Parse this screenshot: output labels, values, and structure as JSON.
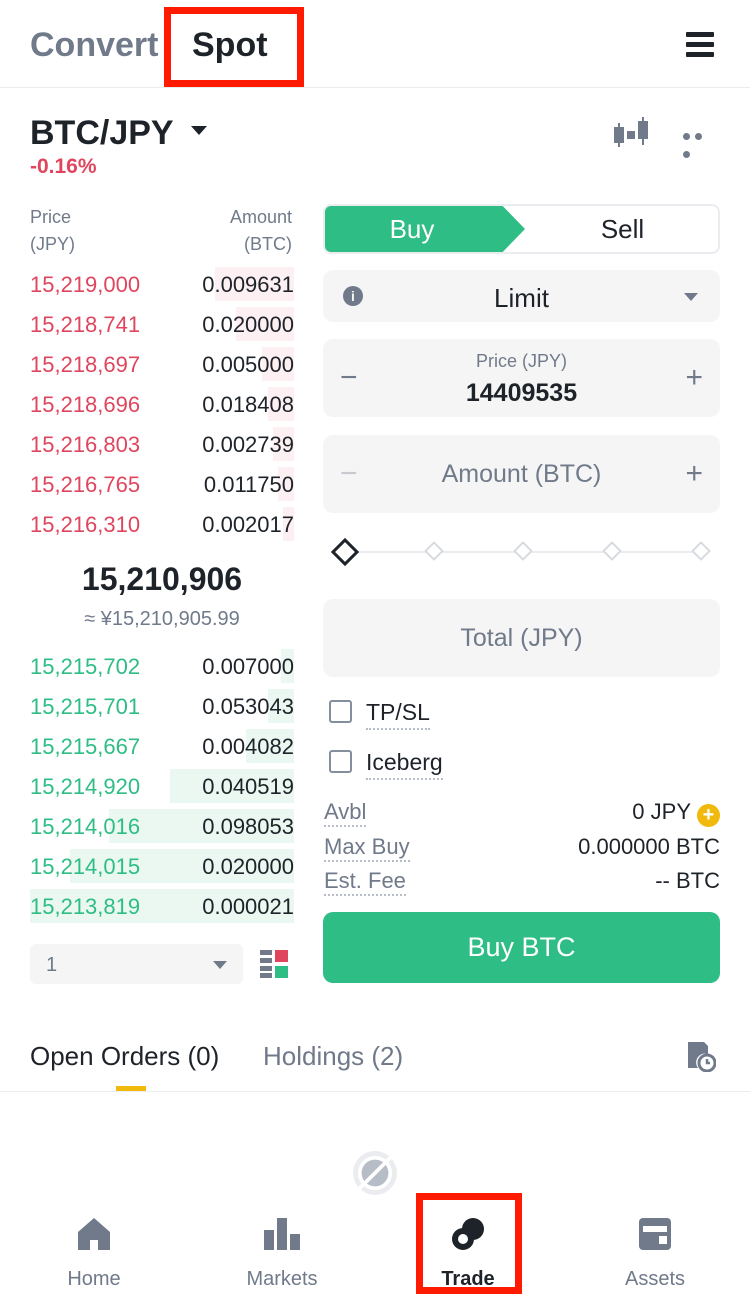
{
  "header": {
    "tab_convert": "Convert",
    "tab_spot": "Spot"
  },
  "market": {
    "pair": "BTC/JPY",
    "change": "-0.16%"
  },
  "orderbook": {
    "price_label": [
      "Price",
      "(JPY)"
    ],
    "amount_label": [
      "Amount",
      "(BTC)"
    ],
    "asks": [
      {
        "price": "15,219,000",
        "amount": "0.009631",
        "depth": 0.3
      },
      {
        "price": "15,218,741",
        "amount": "0.020000",
        "depth": 0.22
      },
      {
        "price": "15,218,697",
        "amount": "0.005000",
        "depth": 0.12
      },
      {
        "price": "15,218,696",
        "amount": "0.018408",
        "depth": 0.1
      },
      {
        "price": "15,216,803",
        "amount": "0.002739",
        "depth": 0.08
      },
      {
        "price": "15,216,765",
        "amount": "0.011750",
        "depth": 0.06
      },
      {
        "price": "15,216,310",
        "amount": "0.002017",
        "depth": 0.04
      }
    ],
    "mid_price": "15,210,906",
    "mid_fiat": "≈ ¥15,210,905.99",
    "bids": [
      {
        "price": "15,215,702",
        "amount": "0.007000",
        "depth": 0.05
      },
      {
        "price": "15,215,701",
        "amount": "0.053043",
        "depth": 0.1
      },
      {
        "price": "15,215,667",
        "amount": "0.004082",
        "depth": 0.18
      },
      {
        "price": "15,214,920",
        "amount": "0.040519",
        "depth": 0.47
      },
      {
        "price": "15,214,016",
        "amount": "0.098053",
        "depth": 0.7
      },
      {
        "price": "15,214,015",
        "amount": "0.020000",
        "depth": 0.85
      },
      {
        "price": "15,213,819",
        "amount": "0.000021",
        "depth": 1.0
      }
    ],
    "depth_value": "1"
  },
  "order_form": {
    "buy_label": "Buy",
    "sell_label": "Sell",
    "order_type": "Limit",
    "price_label": "Price (JPY)",
    "price_value": "14409535",
    "amount_placeholder": "Amount (BTC)",
    "total_placeholder": "Total (JPY)",
    "tpsl_label": "TP/SL",
    "iceberg_label": "Iceberg",
    "avbl_label": "Avbl",
    "avbl_value": "0 JPY",
    "maxbuy_label": "Max Buy",
    "maxbuy_value": "0.000000 BTC",
    "fee_label": "Est. Fee",
    "fee_value": "-- BTC",
    "submit_label": "Buy BTC"
  },
  "orders": {
    "open_label": "Open Orders (0)",
    "holdings_label": "Holdings (2)"
  },
  "nav": {
    "home": "Home",
    "markets": "Markets",
    "trade": "Trade",
    "assets": "Assets"
  },
  "colors": {
    "buy": "#2ebd85",
    "sell": "#e0455e",
    "accent": "#f0b90b",
    "highlight_box": "#ff1a00"
  }
}
